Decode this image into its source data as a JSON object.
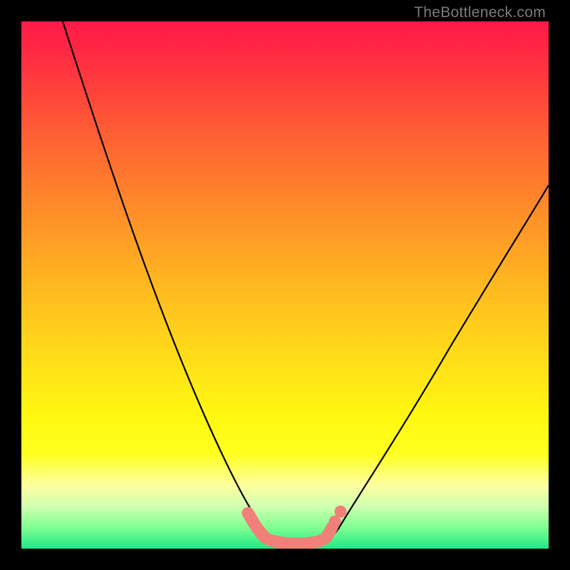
{
  "watermark": "TheBottleneck.com",
  "chart_data": {
    "type": "line",
    "title": "",
    "xlabel": "",
    "ylabel": "",
    "x_range": [
      0,
      100
    ],
    "y_range": [
      0,
      100
    ],
    "series": [
      {
        "name": "left-curve",
        "x": [
          10,
          15,
          20,
          25,
          30,
          35,
          40,
          45,
          47
        ],
        "values": [
          100,
          80,
          62,
          47,
          33,
          21,
          11,
          4,
          1
        ]
      },
      {
        "name": "bottom-flat",
        "x": [
          47,
          50,
          53,
          56,
          59
        ],
        "values": [
          1,
          0.5,
          0.5,
          0.5,
          1.5
        ]
      },
      {
        "name": "right-curve",
        "x": [
          59,
          63,
          68,
          74,
          80,
          86,
          92,
          98,
          100
        ],
        "values": [
          1.5,
          5,
          11,
          20,
          30,
          41,
          53,
          64,
          69
        ]
      }
    ],
    "highlight_segment": {
      "name": "bottom-highlight",
      "x": [
        43,
        47,
        50,
        53,
        56,
        59,
        60
      ],
      "values": [
        5,
        1.5,
        1,
        1,
        1,
        2,
        4
      ]
    },
    "highlight_dots": [
      {
        "x": 59.5,
        "y": 3.2
      },
      {
        "x": 60.5,
        "y": 5.0
      }
    ],
    "colors": {
      "curve": "#000000",
      "highlight": "#f08078",
      "background_top": "#ff1a4a",
      "background_bottom": "#20e888"
    }
  }
}
